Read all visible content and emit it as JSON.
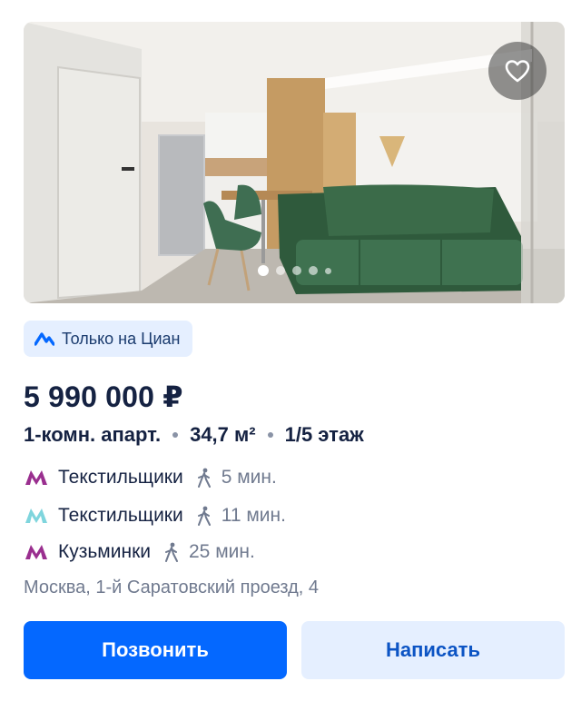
{
  "listing": {
    "badge_text": "Только на Циан",
    "price": "5 990 000 ₽",
    "params": [
      "1-комн. апарт.",
      "34,7 м²",
      "1/5 этаж"
    ],
    "metro": [
      {
        "station": "Текстильщики",
        "time": "5 мин.",
        "line_color": "#9a2f8f"
      },
      {
        "station": "Текстильщики",
        "time": "11 мин.",
        "line_color": "#7fd5dd"
      },
      {
        "station": "Кузьминки",
        "time": "25 мин.",
        "line_color": "#9a2f8f"
      }
    ],
    "address": "Москва, 1-й Саратовский проезд, 4"
  },
  "gallery": {
    "photo_count_dots": 5,
    "active_index": 0
  },
  "actions": {
    "call_label": "Позвонить",
    "write_label": "Написать"
  },
  "colors": {
    "accent": "#0468ff",
    "secondary_button_bg": "#e5efff",
    "text_primary": "#152242",
    "text_secondary": "#707a8f"
  }
}
